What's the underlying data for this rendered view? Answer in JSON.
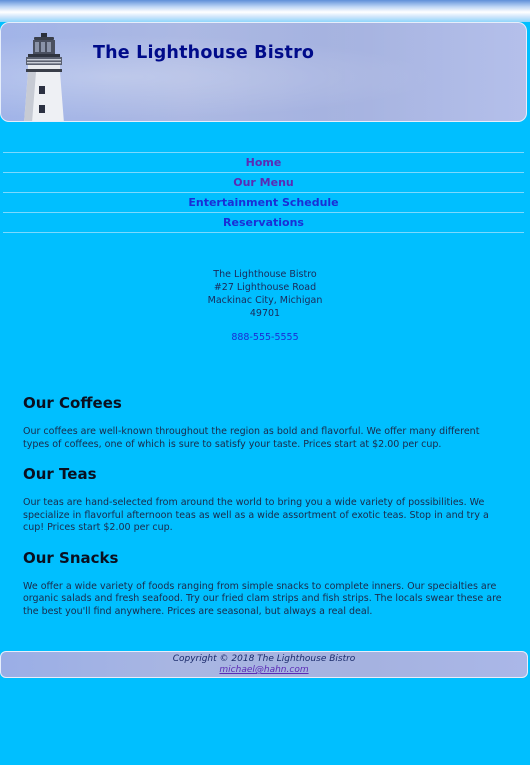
{
  "site": {
    "title": "The Lighthouse Bistro",
    "logo_icon": "lighthouse-icon"
  },
  "nav": {
    "items": [
      {
        "label": "Home"
      },
      {
        "label": "Our Menu"
      },
      {
        "label": "Entertainment Schedule"
      },
      {
        "label": "Reservations"
      }
    ]
  },
  "address": {
    "name": "The Lighthouse Bistro",
    "street": "#27 Lighthouse Road",
    "city": "Mackinac City, Michigan",
    "zip": "49701",
    "phone": "888-555-5555"
  },
  "sections": [
    {
      "heading": "Our Coffees",
      "text": "Our coffees are well-known throughout the region as bold and flavorful. We offer many different types of coffees, one of which is sure to satisfy your taste. Prices start at $2.00 per cup."
    },
    {
      "heading": "Our Teas",
      "text": "Our teas are hand-selected from around the world to bring you a wide variety of possibilities. We specialize in flavorful afternoon teas as well as a wide assortment of exotic teas. Stop in and try a cup! Prices start $2.00 per cup."
    },
    {
      "heading": "Our Snacks",
      "text": "We offer a wide variety of foods ranging from simple snacks to complete inners. Our specialties are organic salads and fresh seafood. Try our fried clam strips and fish strips. The locals swear these are the best you'll find anywhere. Prices are seasonal, but always a real deal."
    }
  ],
  "footer": {
    "copyright": "Copyright © 2018 The Lighthouse Bistro",
    "email": "michael@hahn.com"
  },
  "colors": {
    "background": "#00bfff",
    "header": "#a5b2e0",
    "title": "#000b8a",
    "link": "#1a2fd6",
    "visited_link": "#5b2bb5"
  }
}
